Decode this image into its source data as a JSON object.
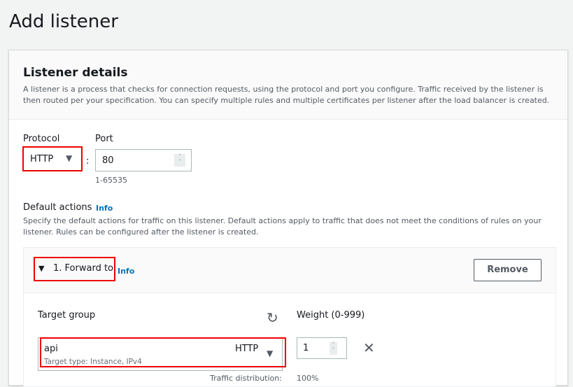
{
  "page_title": "Add listener",
  "listener_details": {
    "title": "Listener details",
    "description": "A listener is a process that checks for connection requests, using the protocol and port you configure. Traffic received by the listener is then routed per your specification. You can specify multiple rules and multiple certificates per listener after the load balancer is created."
  },
  "protocol": {
    "label": "Protocol",
    "value": "HTTP",
    "separator": ":"
  },
  "port": {
    "label": "Port",
    "value": "80",
    "hint": "1-65535"
  },
  "default_actions": {
    "label": "Default actions",
    "info": "Info",
    "description": "Specify the default actions for traffic on this listener. Default actions apply to traffic that does not meet the conditions of rules on your listener. Rules can be configured after the listener is created."
  },
  "action": {
    "title": "1. Forward to",
    "info": "Info",
    "remove_label": "Remove",
    "target_group_label": "Target group",
    "weight_label": "Weight (0-999)",
    "target_group": {
      "name": "api",
      "protocol": "HTTP",
      "subtext": "Target type: Instance, IPv4"
    },
    "weight": "1",
    "traffic_label": "Traffic distribution:",
    "traffic_value": "100%"
  },
  "colors": {
    "highlight": "#ee0000",
    "link": "#0073bb"
  }
}
